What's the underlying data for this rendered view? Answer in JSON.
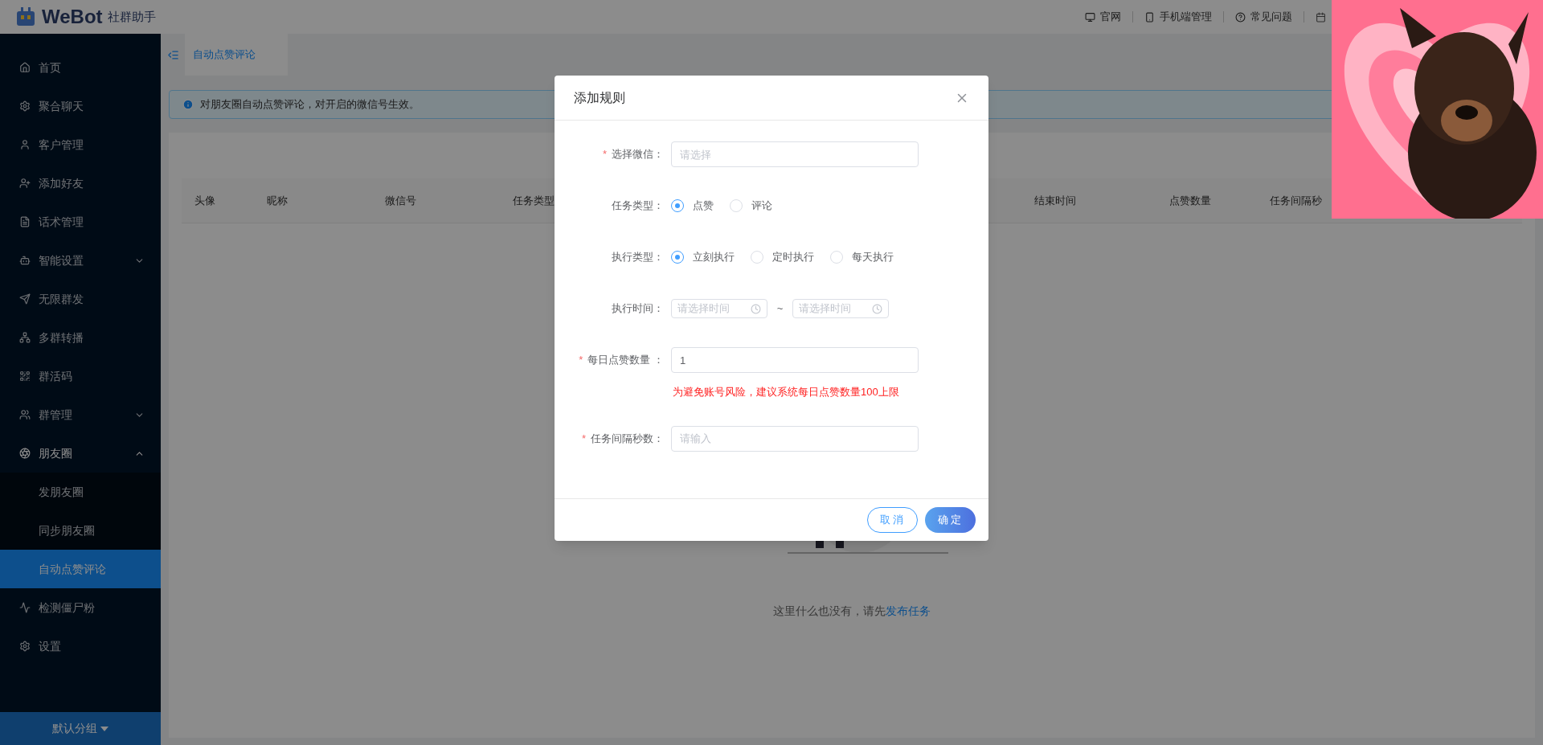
{
  "header": {
    "logo": "WeBot",
    "logo_sub": "社群助手",
    "links": [
      {
        "label": "官网"
      },
      {
        "label": "手机端管理"
      },
      {
        "label": "常见问题"
      }
    ]
  },
  "sidebar": {
    "items": [
      {
        "label": "首页"
      },
      {
        "label": "聚合聊天"
      },
      {
        "label": "客户管理"
      },
      {
        "label": "添加好友"
      },
      {
        "label": "话术管理"
      },
      {
        "label": "智能设置",
        "expanded": false
      },
      {
        "label": "无限群发"
      },
      {
        "label": "多群转播"
      },
      {
        "label": "群活码"
      },
      {
        "label": "群管理",
        "expanded": false
      },
      {
        "label": "朋友圈",
        "expanded": true,
        "children": [
          {
            "label": "发朋友圈",
            "selected": false
          },
          {
            "label": "同步朋友圈",
            "selected": false
          },
          {
            "label": "自动点赞评论",
            "selected": true
          }
        ]
      },
      {
        "label": "检测僵尸粉"
      },
      {
        "label": "设置"
      }
    ],
    "group_switch": "默认分组"
  },
  "tabs": [
    {
      "label": "自动点赞评论",
      "selected": true
    }
  ],
  "alert": "对朋友圈自动点赞评论，对开启的微信号生效。",
  "table": {
    "columns_left": [
      "头像",
      "昵称",
      "微信号",
      "任务类型"
    ],
    "columns_right": [
      "结束时间",
      "点赞数量",
      "任务间隔秒"
    ]
  },
  "empty": {
    "text": "这里什么也没有，请先",
    "link": "发布任务"
  },
  "dialog": {
    "title": "添加规则",
    "required_mark": "*",
    "fields": [
      {
        "kind": "select",
        "label": "选择微信：",
        "required": true,
        "placeholder": "请选择"
      },
      {
        "kind": "radio",
        "label": "任务类型：",
        "required": false,
        "options": [
          {
            "label": "点赞",
            "selected": true
          },
          {
            "label": "评论",
            "selected": false
          }
        ]
      },
      {
        "kind": "radio",
        "label": "执行类型：",
        "required": false,
        "options": [
          {
            "label": "立刻执行",
            "selected": true
          },
          {
            "label": "定时执行",
            "selected": false
          },
          {
            "label": "每天执行",
            "selected": false
          }
        ]
      },
      {
        "kind": "time_range",
        "label": "执行时间：",
        "required": false,
        "start_placeholder": "请选择时间",
        "separator": "~",
        "end_placeholder": "请选择时间"
      },
      {
        "kind": "input",
        "label": "每日点赞数量 ：",
        "required": true,
        "value": "1",
        "hint": "为避免账号风险，建议系统每日点赞数量100上限"
      },
      {
        "kind": "input",
        "label": "任务间隔秒数：",
        "required": true,
        "placeholder": "请输入"
      }
    ],
    "buttons": [
      {
        "label": "取消",
        "kind": "secondary"
      },
      {
        "label": "确定",
        "kind": "primary"
      }
    ]
  }
}
